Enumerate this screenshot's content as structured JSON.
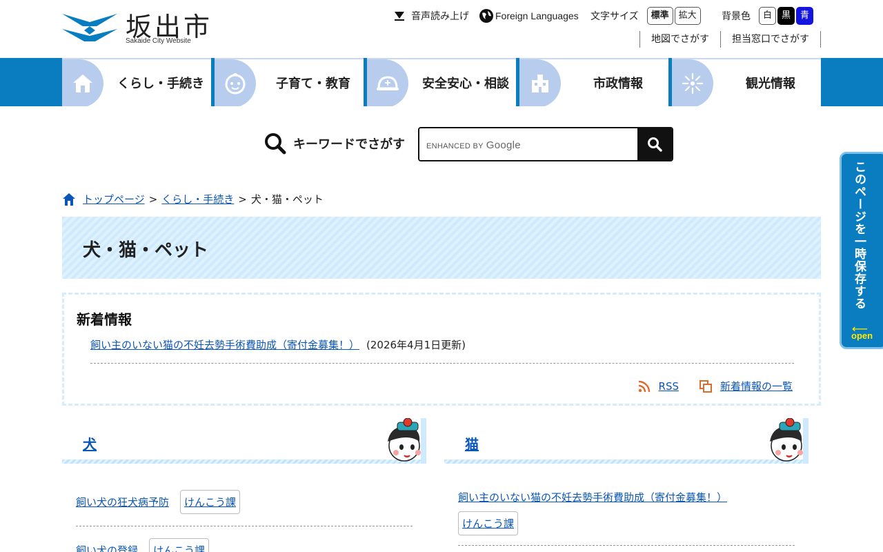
{
  "header": {
    "logo_jp": "坂出市",
    "logo_en": "Sakaide City Website",
    "speech_label": "音声読み上げ",
    "lang_label": "Foreign Languages",
    "text_size_label": "文字サイズ",
    "size_standard": "標準",
    "size_large": "拡大",
    "bg_label": "背景色",
    "bg_white": "白",
    "bg_black": "黒",
    "bg_blue": "青",
    "map_search": "地図でさがす",
    "dept_search": "担当窓口でさがす"
  },
  "nav": {
    "items": [
      {
        "label": "くらし・手続き",
        "icon": "house-icon"
      },
      {
        "label": "子育て・教育",
        "icon": "baby-icon"
      },
      {
        "label": "安全安心・相談",
        "icon": "helmet-icon"
      },
      {
        "label": "市政情報",
        "icon": "building-icon"
      },
      {
        "label": "観光情報",
        "icon": "firework-icon"
      }
    ]
  },
  "search": {
    "label": "キーワードでさがす",
    "enhanced_by": "ENHANCED BY",
    "google": "Google"
  },
  "sidetab": {
    "text": "このページを一時保存する",
    "open": "open"
  },
  "breadcrumb": {
    "home": "トップページ",
    "parent": "くらし・手続き",
    "current": "犬・猫・ペット",
    "sep": ">"
  },
  "page_title": "犬・猫・ペット",
  "news": {
    "heading": "新着情報",
    "item_title": "飼い主のいない猫の不妊去勢手術費助成（寄付金募集！）",
    "item_date": "(2026年4月1日更新)",
    "rss": "RSS",
    "list_link": "新着情報の一覧"
  },
  "columns": {
    "dog": {
      "heading": "犬",
      "entries": [
        {
          "title": "飼い犬の狂犬病予防",
          "tag": "けんこう課"
        },
        {
          "title": "飼い犬の登録",
          "tag": "けんこう課"
        }
      ]
    },
    "cat": {
      "heading": "猫",
      "entries": [
        {
          "title": "飼い主のいない猫の不妊去勢手術費助成（寄付金募集！）",
          "tag": "けんこう課"
        }
      ]
    }
  },
  "colors": {
    "nav_blue": "#0a7cc0",
    "nav_bump": "#b8cdee",
    "title_band": "#d5edff",
    "link": "#0a56b8",
    "bg_blue_button": "#1515e0"
  }
}
